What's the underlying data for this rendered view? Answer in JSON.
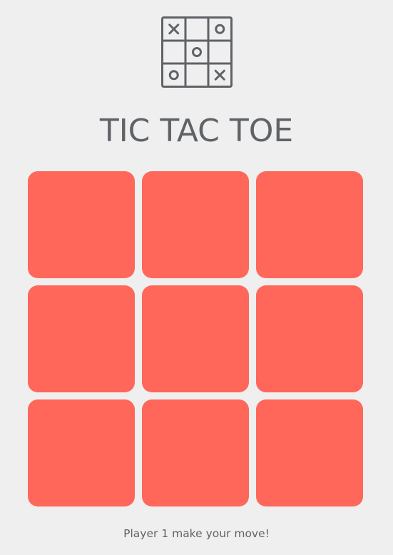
{
  "game": {
    "title": "TIC TAC TOE",
    "status": "Player 1 make your move!"
  },
  "logo": {
    "icon": "tic-tac-toe-logo-icon",
    "grid": [
      "X",
      "",
      "O",
      "",
      "O",
      "",
      "O",
      "",
      "X"
    ],
    "color": "#5f6368"
  },
  "board": {
    "cells": [
      "",
      "",
      "",
      "",
      "",
      "",
      "",
      "",
      ""
    ],
    "cell_color": "#ff675a"
  },
  "colors": {
    "background": "#efefef",
    "text": "#5f6368",
    "cell": "#ff675a"
  }
}
